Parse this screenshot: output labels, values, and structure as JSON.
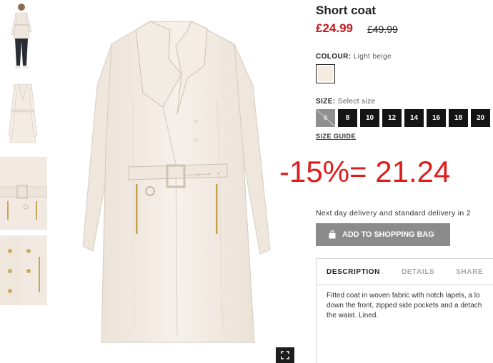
{
  "product": {
    "title": "Short coat",
    "price_now": "£24.99",
    "price_old": "£49.99"
  },
  "colour": {
    "label": "COLOUR:",
    "value": "Light beige",
    "swatch_hex": "#f4ebe1"
  },
  "size": {
    "label": "SIZE:",
    "value": "Select size",
    "options": [
      "6",
      "8",
      "10",
      "12",
      "14",
      "16",
      "18",
      "20"
    ],
    "unavailable": [
      "6"
    ],
    "guide_label": "SIZE GUIDE"
  },
  "annotation": {
    "discount_note": "-15%= 21.24"
  },
  "delivery": {
    "text": "Next day delivery and standard delivery in 2"
  },
  "cart": {
    "add_label": "ADD TO SHOPPING BAG"
  },
  "tabs": [
    {
      "label": "DESCRIPTION",
      "active": true
    },
    {
      "label": "DETAILS",
      "active": false
    },
    {
      "label": "SHARE",
      "active": false
    }
  ],
  "description": {
    "lines": [
      "Fitted coat in woven fabric with notch lapels, a lo",
      "down the front, zipped side pockets and a detach",
      "the waist. Lined."
    ]
  },
  "colors": {
    "price_red": "#c41a1a",
    "annotation_red": "#e01b1b",
    "button_grey": "#8b8b8b",
    "coat": "#f3ece5"
  },
  "icons": {
    "expand": "expand-icon",
    "bag": "shopping-bag-icon"
  }
}
